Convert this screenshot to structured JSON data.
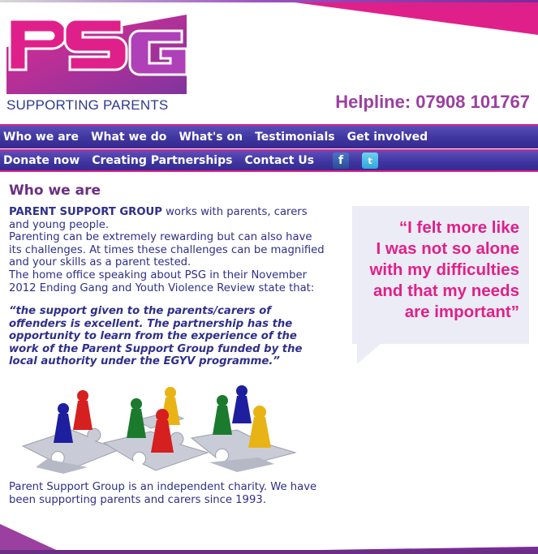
{
  "header": {
    "logo_text": "PSG",
    "tagline": "SUPPORTING PARENTS",
    "helpline": "Helpline: 07908 101767"
  },
  "nav": {
    "row1": [
      "Who we are",
      "What we do",
      "What's on",
      "Testimonials",
      "Get involved"
    ],
    "row2": [
      "Donate now",
      "Creating Partnerships",
      "Contact Us"
    ],
    "social": [
      {
        "icon": "facebook-icon",
        "glyph": "f"
      },
      {
        "icon": "twitter-icon",
        "glyph": "t"
      }
    ]
  },
  "content": {
    "heading": "Who we are",
    "intro_bold": "PARENT SUPPORT GROUP",
    "intro_rest": " works with parents, carers and young people.",
    "para2": "Parenting can be extremely rewarding but can also have its challenges. At times these challenges can be magnified and your skills as a parent tested.",
    "para3": "The home office speaking about PSG in their November 2012 Ending Gang and Youth Violence Review state that:",
    "quote": "“the support given to the parents/carers of offenders is excellent. The partnership has the opportunity to learn from the experience of the work of the Parent Support Group funded by the local authority under the EGYV programme.”",
    "closing": "Parent Support Group is an independent charity. We have been supporting parents and carers since 1993."
  },
  "testimonial": {
    "lines": [
      "“I felt more like",
      "I was not so alone",
      "with my difficulties",
      "and that my needs",
      "are important”"
    ]
  },
  "colors": {
    "brand_pink": "#e0208a",
    "brand_purple": "#9b3fa0",
    "nav_blue": "#3f35a0",
    "text_navy": "#2f2f8a",
    "bubble_bg": "#ececf6"
  }
}
